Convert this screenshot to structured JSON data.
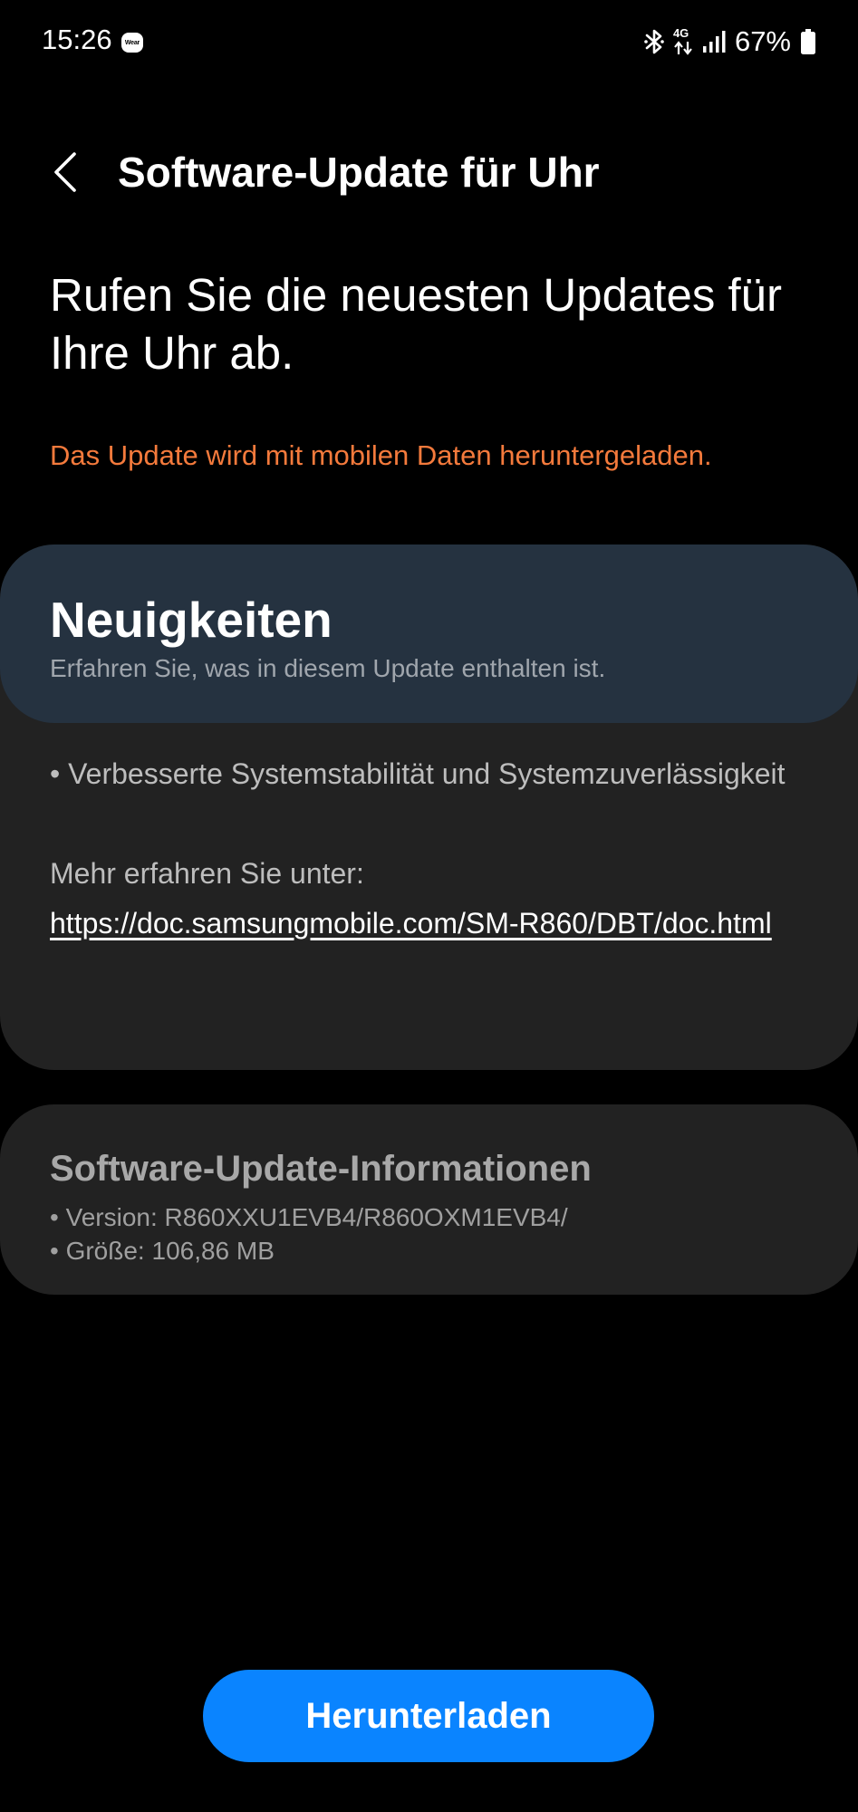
{
  "status_bar": {
    "time": "15:26",
    "wear_badge": "Wear",
    "network": "4G",
    "battery": "67%",
    "icons": [
      "wear-icon",
      "bluetooth-icon",
      "network-4g-icon",
      "signal-icon",
      "battery-icon"
    ]
  },
  "header": {
    "back_icon": "chevron-left-icon",
    "title": "Software-Update für Uhr"
  },
  "intro": {
    "headline": "Rufen Sie die neuesten Updates für Ihre Uhr ab.",
    "warning": "Das Update wird mit mobilen Daten heruntergeladen."
  },
  "news": {
    "title": "Neuigkeiten",
    "subtitle": "Erfahren Sie, was in diesem Update enthalten ist.",
    "items": [
      "• Verbesserte Systemstabilität und Systemzuverlässigkeit"
    ],
    "more_label": "Mehr erfahren Sie unter:",
    "link": "https://doc.samsungmobile.com/SM-R860/DBT/doc.html"
  },
  "info": {
    "title": "Software-Update-Informationen",
    "version": "• Version: R860XXU1EVB4/R860OXM1EVB4/",
    "size": "• Größe: 106,86 MB"
  },
  "actions": {
    "download_label": "Herunterladen"
  },
  "colors": {
    "background": "#000000",
    "warning": "#f47a3c",
    "news_header": "#253240",
    "card": "#222222",
    "accent": "#0a84ff"
  }
}
